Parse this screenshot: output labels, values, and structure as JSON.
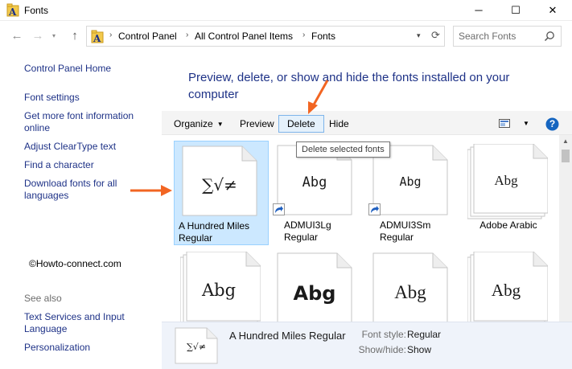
{
  "window": {
    "title": "Fonts",
    "minimize_glyph": "─",
    "maximize_glyph": "☐",
    "close_glyph": "✕"
  },
  "navigation": {
    "back_glyph": "←",
    "forward_glyph": "→",
    "recent_glyph": "▾",
    "up_glyph": "↑",
    "breadcrumbs": [
      "Control Panel",
      "All Control Panel Items",
      "Fonts"
    ],
    "crumb_separator": "›",
    "dropdown_glyph": "▾",
    "refresh_glyph": "⟳",
    "search_placeholder": "Search Fonts"
  },
  "left_pane": {
    "home_link": "Control Panel Home",
    "links": [
      "Font settings",
      "Get more font information online",
      "Adjust ClearType text",
      "Find a character",
      "Download fonts for all languages"
    ],
    "see_also_header": "See also",
    "see_also_links": [
      "Text Services and Input Language",
      "Personalization"
    ]
  },
  "watermark": "©Howto-connect.com",
  "heading": "Preview, delete, or show and hide the fonts installed on your computer",
  "toolbar": {
    "organize_label": "Organize",
    "organize_caret": "▼",
    "preview_label": "Preview",
    "delete_label": "Delete",
    "hide_label": "Hide",
    "view_caret": "▼",
    "help_glyph": "?"
  },
  "tooltip": "Delete selected fonts",
  "fonts": [
    {
      "name": "A Hundred Miles Regular",
      "sample": "∑√≠",
      "selected": true,
      "family_stack": false,
      "shortcut": false
    },
    {
      "name": "ADMUI3Lg Regular",
      "sample": "Abg",
      "selected": false,
      "family_stack": false,
      "shortcut": true
    },
    {
      "name": "ADMUI3Sm Regular",
      "sample": "Abg",
      "selected": false,
      "family_stack": false,
      "shortcut": true
    },
    {
      "name": "Adobe Arabic",
      "sample": "Abg",
      "selected": false,
      "family_stack": true,
      "shortcut": false
    },
    {
      "name": "",
      "sample": "Abg",
      "selected": false,
      "family_stack": true,
      "shortcut": false
    },
    {
      "name": "",
      "sample": "Abg",
      "selected": false,
      "family_stack": false,
      "shortcut": false
    },
    {
      "name": "",
      "sample": "Abg",
      "selected": false,
      "family_stack": false,
      "shortcut": false
    },
    {
      "name": "",
      "sample": "Abg",
      "selected": false,
      "family_stack": true,
      "shortcut": false
    }
  ],
  "scrollbar": {
    "up_glyph": "▲"
  },
  "details": {
    "preview_sample": "∑√≠",
    "font_name": "A Hundred Miles Regular",
    "style_label": "Font style:",
    "style_value": "Regular",
    "showhide_label": "Show/hide:",
    "showhide_value": "Show"
  },
  "colors": {
    "link_blue": "#1e3287",
    "annotation_orange": "#f26522",
    "selection_fill": "#cce8ff",
    "selection_border": "#99d1ff",
    "details_bg": "#eff3fa",
    "help_blue": "#1565c0"
  },
  "icons": {
    "window_icon": "fonts-folder-icon",
    "address_icon": "fonts-folder-icon",
    "search_icon": "magnifier-icon",
    "view_icon": "view-options-icon",
    "help_icon": "help-circle-icon",
    "shortcut_icon": "shortcut-arrow-icon"
  }
}
